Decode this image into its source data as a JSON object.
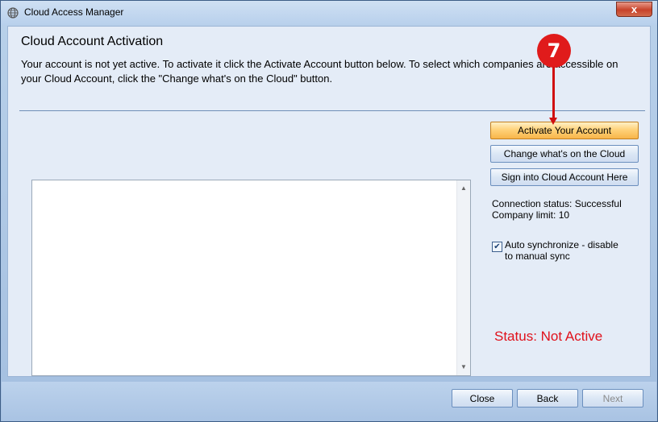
{
  "window": {
    "title": "Cloud Access Manager",
    "close_glyph": "x"
  },
  "header": {
    "title": "Cloud Account Activation",
    "description": "Your account is not yet active. To activate it click the Activate Account button below. To select which companies are accessible on your Cloud Account, click the \"Change what's on the Cloud\" button."
  },
  "actions": {
    "activate": "Activate Your Account",
    "change": "Change what's on the Cloud",
    "signin": "Sign into Cloud Account Here"
  },
  "status": {
    "connection": "Connection status: Successful",
    "company_limit": "Company limit: 10",
    "auto_sync_label": "Auto synchronize - disable to manual sync",
    "auto_sync_checked": true,
    "account_status": "Status: Not Active"
  },
  "footer": {
    "close": "Close",
    "back": "Back",
    "next": "Next"
  },
  "annotation": {
    "step_number": "7",
    "color": "#e01b1b"
  },
  "icons": {
    "title_icon": "globe-icon",
    "scroll_up": "arrow-up-icon",
    "scroll_down": "arrow-down-icon"
  }
}
